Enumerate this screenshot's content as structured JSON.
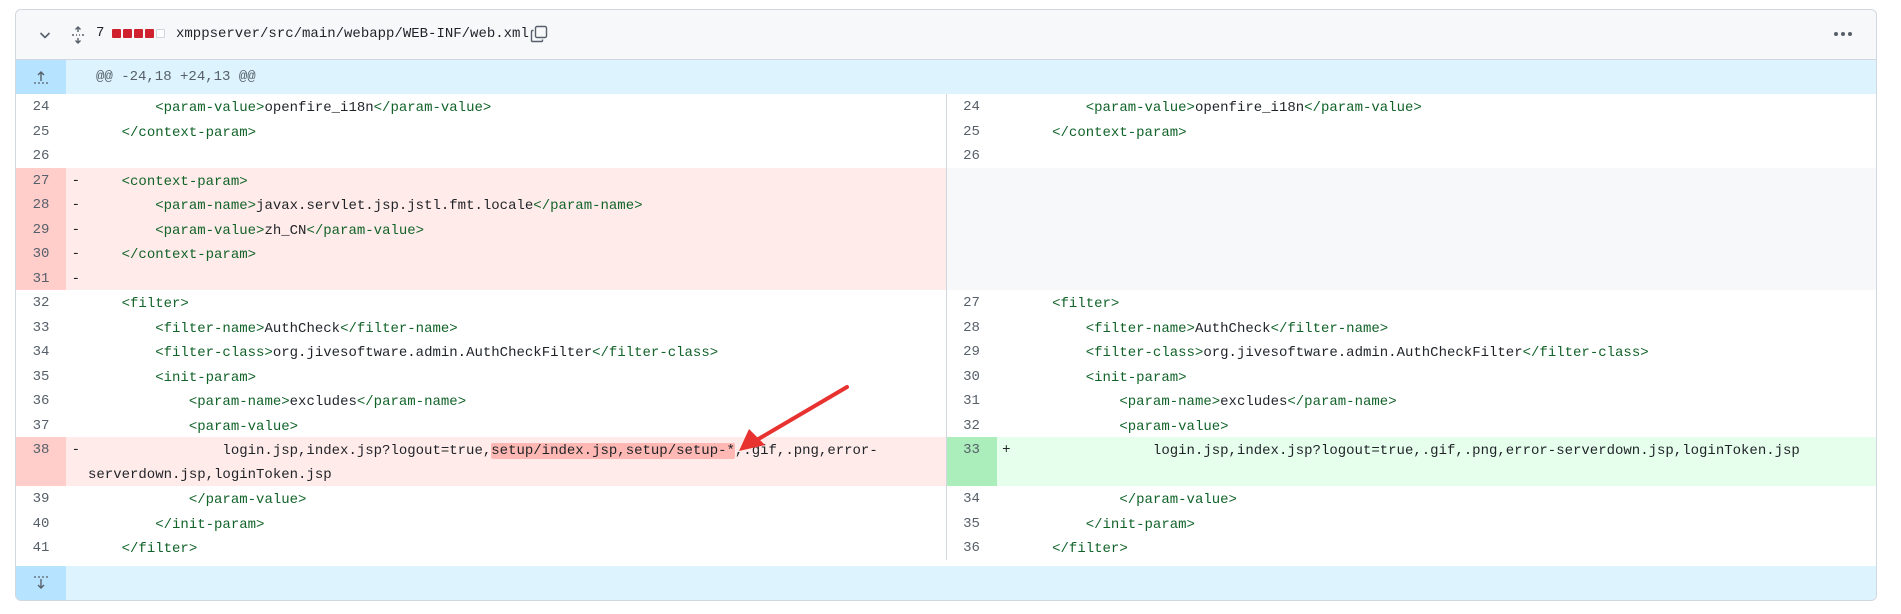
{
  "file": {
    "change_count": "7",
    "path": "xmppserver/src/main/webapp/WEB-INF/web.xml",
    "diffstat": [
      "del",
      "del",
      "del",
      "del",
      "neutral"
    ],
    "colors": {
      "del": "#cf222e",
      "neutral": "#d0d7de"
    },
    "icons": {
      "collapse": "chevron-down-icon",
      "expand": "unfold-icon",
      "copy": "copy-icon",
      "menu": "kebab-horizontal-icon"
    }
  },
  "hunk": {
    "header": "@@ -24,18 +24,13 @@"
  },
  "lines": {
    "l24": "24",
    "l25": "25",
    "l26": "26",
    "l27": "27",
    "l28": "28",
    "l29": "29",
    "l30": "30",
    "l31": "31",
    "l32": "32",
    "l33": "33",
    "l34": "34",
    "l35": "35",
    "l36": "36",
    "l37": "37",
    "l38": "38",
    "l39": "39",
    "l40": "40",
    "l41": "41",
    "r24": "24",
    "r25": "25",
    "r26": "26",
    "r27": "27",
    "r28": "28",
    "r29": "29",
    "r30": "30",
    "r31": "31",
    "r32": "32",
    "r33": "33",
    "r34": "34",
    "r35": "35",
    "r36": "36"
  },
  "markers": {
    "minus": "-",
    "plus": "+"
  },
  "code": {
    "indent8": "        ",
    "indent4": "    ",
    "indent12": "            ",
    "pv_open": "<param-value>",
    "pv_close": "</param-value>",
    "openfire": "openfire_i18n",
    "cp_close": "</context-param>",
    "cp_open": "<context-param>",
    "pn_open": "<param-name>",
    "pn_close": "</param-name>",
    "locale": "javax.servlet.jsp.jstl.fmt.locale",
    "zh": "zh_CN",
    "filter_open": "<filter>",
    "filter_close": "</filter>",
    "fn_open": "<filter-name>",
    "fn_close": "</filter-name>",
    "authcheck": "AuthCheck",
    "fc_open": "<filter-class>",
    "fc_close": "</filter-class>",
    "authfilter": "org.jivesoftware.admin.AuthCheckFilter",
    "ip_open": "<init-param>",
    "ip_close": "</init-param>",
    "excludes": "excludes",
    "old_pre": "                login.jsp,index.jsp?logout=true,",
    "old_hl": "setup/index.jsp,setup/setup-*",
    "old_post": ",.gif,.png,error-serverdown.jsp,loginToken.jsp",
    "new_line": "                login.jsp,index.jsp?logout=true,.gif,.png,error-serverdown.jsp,loginToken.jsp"
  }
}
